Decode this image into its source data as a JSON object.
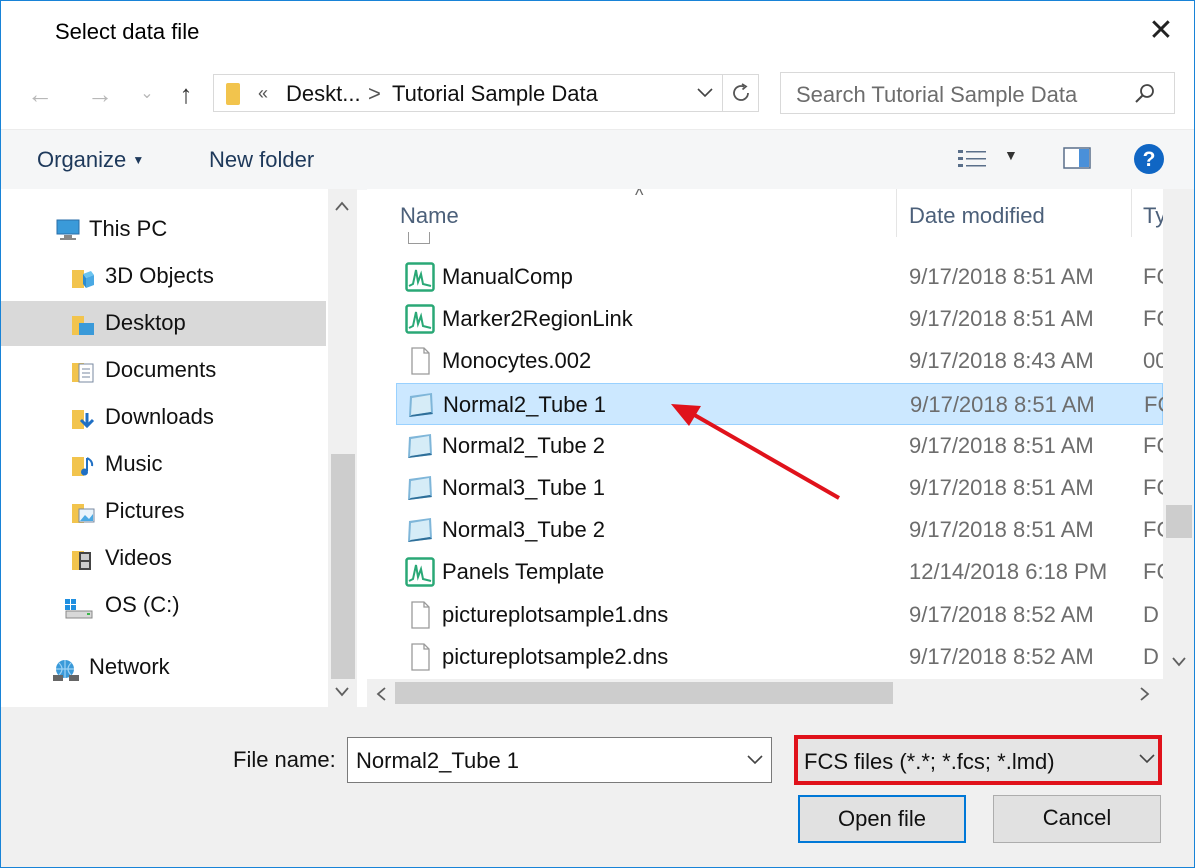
{
  "window": {
    "title": "Select data file"
  },
  "address": {
    "overflow": "«",
    "crumb1": "Deskt...",
    "separator": ">",
    "crumb2": "Tutorial Sample Data"
  },
  "search": {
    "placeholder": "Search Tutorial Sample Data"
  },
  "toolbar": {
    "organize": "Organize",
    "new_folder": "New folder"
  },
  "nav": {
    "items": [
      {
        "label": "This PC",
        "icon": "computer-icon"
      },
      {
        "label": "3D Objects",
        "icon": "3d-objects-icon"
      },
      {
        "label": "Desktop",
        "icon": "desktop-folder-icon",
        "selected": true
      },
      {
        "label": "Documents",
        "icon": "documents-icon"
      },
      {
        "label": "Downloads",
        "icon": "downloads-icon"
      },
      {
        "label": "Music",
        "icon": "music-icon"
      },
      {
        "label": "Pictures",
        "icon": "pictures-icon"
      },
      {
        "label": "Videos",
        "icon": "videos-icon"
      },
      {
        "label": "OS (C:)",
        "icon": "drive-icon"
      },
      {
        "label": "Network",
        "icon": "network-icon"
      }
    ]
  },
  "columns": {
    "name": "Name",
    "date": "Date modified",
    "type": "Ty"
  },
  "files": [
    {
      "name": "ManualComp",
      "date": "9/17/2018 8:51 AM",
      "type": "FC",
      "icon": "layout-file-icon"
    },
    {
      "name": "Marker2RegionLink",
      "date": "9/17/2018 8:51 AM",
      "type": "FC",
      "icon": "layout-file-icon"
    },
    {
      "name": "Monocytes.002",
      "date": "9/17/2018 8:43 AM",
      "type": "00",
      "icon": "blank-file-icon"
    },
    {
      "name": "Normal2_Tube 1",
      "date": "9/17/2018 8:51 AM",
      "type": "FC",
      "icon": "fcs-file-icon",
      "selected": true
    },
    {
      "name": "Normal2_Tube 2",
      "date": "9/17/2018 8:51 AM",
      "type": "FC",
      "icon": "fcs-file-icon"
    },
    {
      "name": "Normal3_Tube 1",
      "date": "9/17/2018 8:51 AM",
      "type": "FC",
      "icon": "fcs-file-icon"
    },
    {
      "name": "Normal3_Tube 2",
      "date": "9/17/2018 8:51 AM",
      "type": "FC",
      "icon": "fcs-file-icon"
    },
    {
      "name": "Panels Template",
      "date": "12/14/2018 6:18 PM",
      "type": "FC",
      "icon": "layout-file-icon"
    },
    {
      "name": "pictureplotsample1.dns",
      "date": "9/17/2018 8:52 AM",
      "type": "D",
      "icon": "blank-file-icon"
    },
    {
      "name": "pictureplotsample2.dns",
      "date": "9/17/2018 8:52 AM",
      "type": "D",
      "icon": "blank-file-icon"
    }
  ],
  "footer": {
    "file_name_label": "File name:",
    "file_name_value": "Normal2_Tube 1",
    "file_type_value": "FCS files (*.*; *.fcs; *.lmd)",
    "open_label": "Open file",
    "cancel_label": "Cancel"
  },
  "colors": {
    "accent": "#0078d7",
    "selection": "#cce8ff",
    "highlight_annotation": "#e0121b"
  }
}
